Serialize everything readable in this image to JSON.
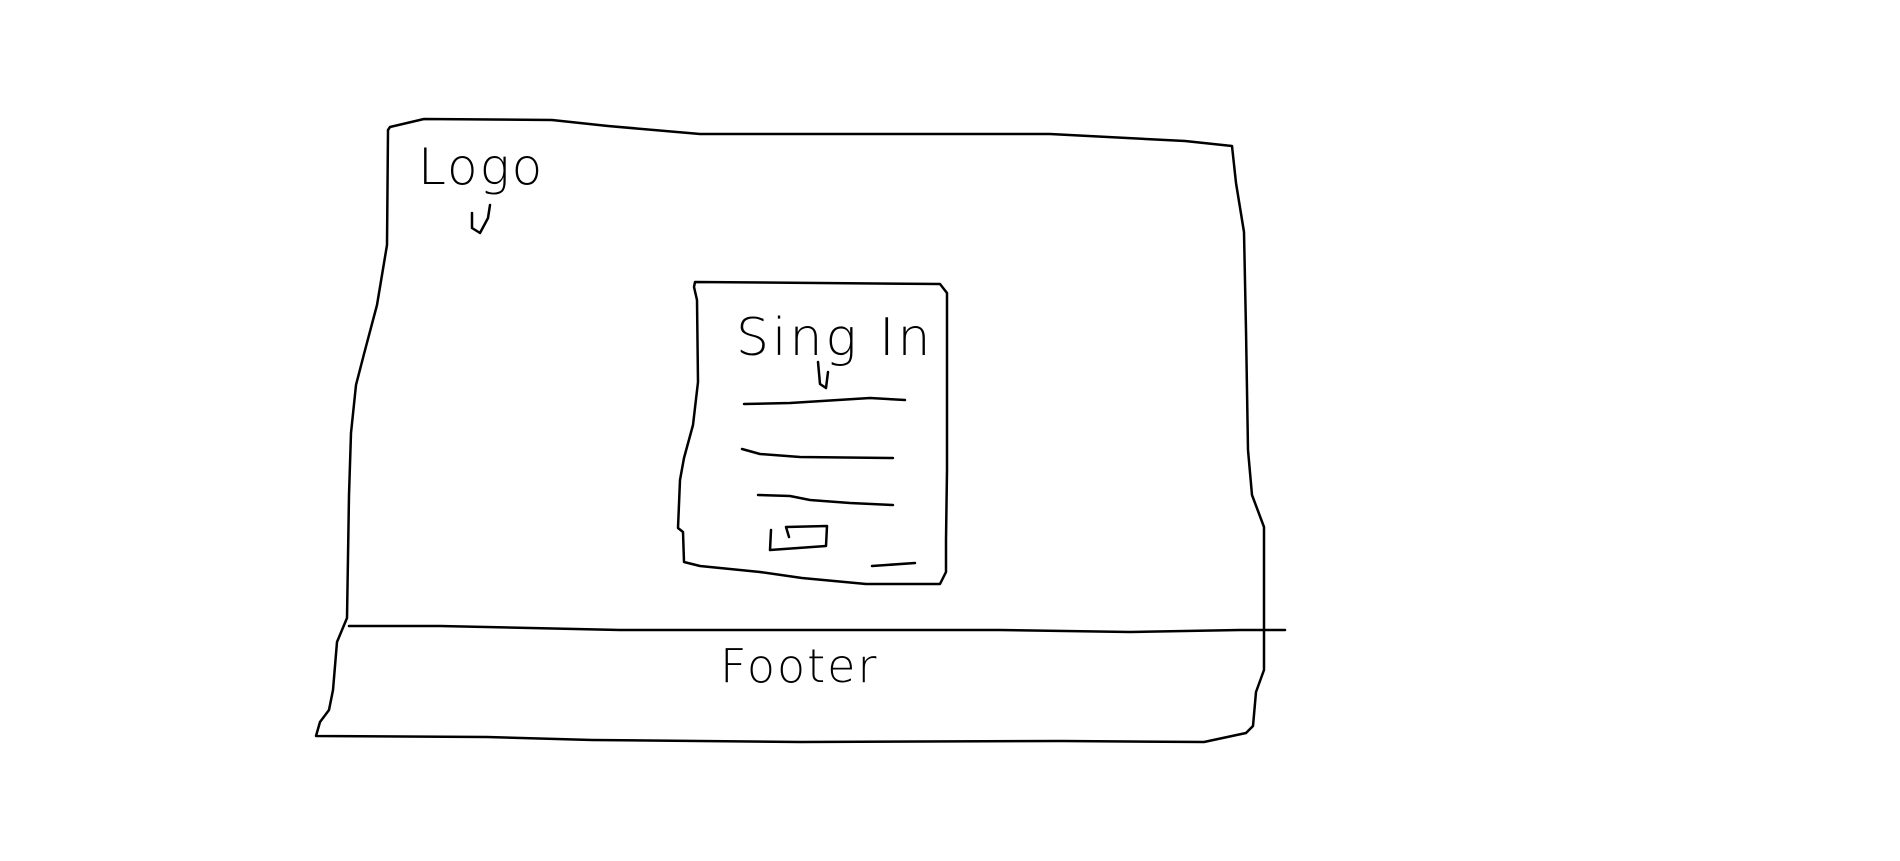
{
  "wireframe": {
    "header": {
      "logo_label": "Logo"
    },
    "signin_card": {
      "title": "Sing In",
      "fields": [
        {
          "kind": "input-line"
        },
        {
          "kind": "input-line"
        },
        {
          "kind": "input-line"
        }
      ],
      "button": {
        "kind": "box"
      },
      "link": {
        "kind": "underline"
      }
    },
    "footer": {
      "label": "Footer"
    }
  },
  "colors": {
    "background": "#ffffff",
    "ink": "#000000"
  }
}
